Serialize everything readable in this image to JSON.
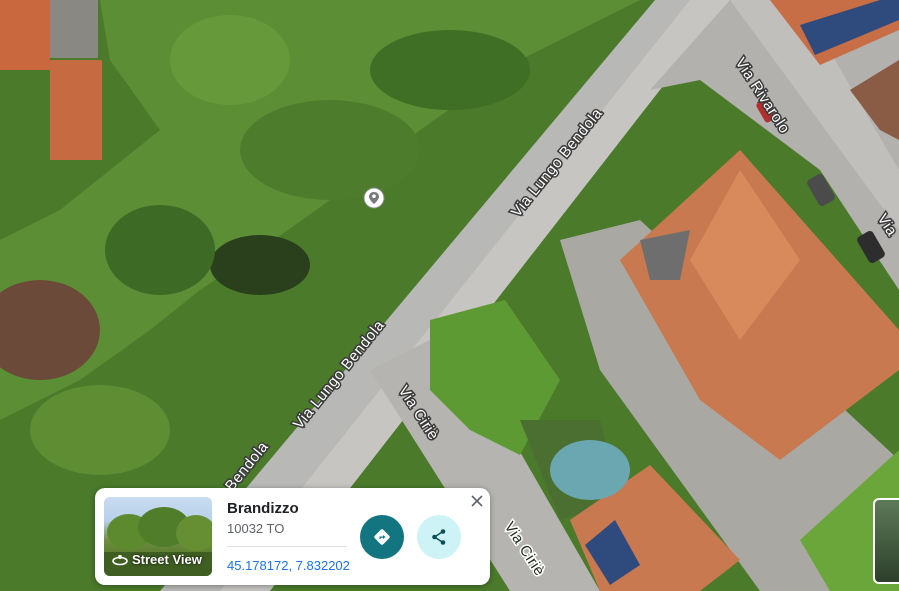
{
  "map": {
    "roads": [
      {
        "id": "lungo-upper",
        "label": "Via Lungo Bendola"
      },
      {
        "id": "lungo-lower",
        "label": "Via Lungo Bendola"
      },
      {
        "id": "lungo-edge",
        "label": "Bendola"
      },
      {
        "id": "rivarolo",
        "label": "Via Rivarolo"
      },
      {
        "id": "rivarolo-edge",
        "label": "Via"
      },
      {
        "id": "cirie-upper",
        "label": "Via Ciriè"
      },
      {
        "id": "cirie-lower",
        "label": "Via Ciriè"
      }
    ],
    "pin_icon": "place-pin-icon"
  },
  "info_card": {
    "thumbnail_label": "Street View",
    "street_view_icon": "street-view-360-icon",
    "place_name": "Brandizzo",
    "place_sub": "10032 TO",
    "coordinates": "45.178172, 7.832202",
    "directions_icon": "directions-icon",
    "share_icon": "share-icon",
    "close_icon": "close-icon",
    "colors": {
      "directions_button": "#13757f",
      "share_button": "#cdf3f7",
      "coordinates_text": "#1a73e8"
    }
  },
  "street_view_preview_icon": "street-view-preview"
}
